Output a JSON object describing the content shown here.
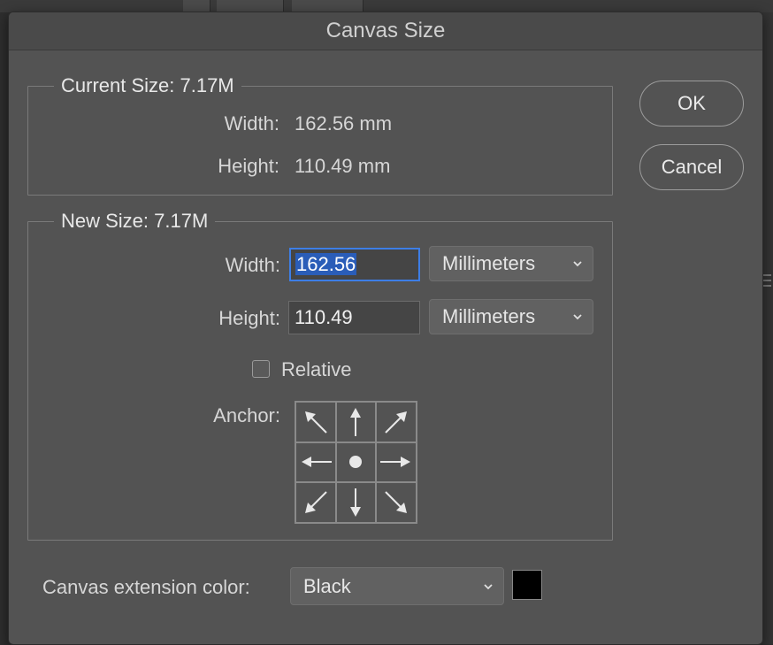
{
  "dialog": {
    "title": "Canvas Size"
  },
  "current_size": {
    "legend": "Current Size: 7.17M",
    "width_label": "Width:",
    "width_value": "162.56 mm",
    "height_label": "Height:",
    "height_value": "110.49 mm"
  },
  "new_size": {
    "legend": "New Size: 7.17M",
    "width_label": "Width:",
    "width_value": "162.56",
    "width_unit": "Millimeters",
    "height_label": "Height:",
    "height_value": "110.49",
    "height_unit": "Millimeters",
    "relative_label": "Relative",
    "relative_checked": false,
    "anchor_label": "Anchor:",
    "anchor_icons": [
      "arrow-up-left-icon",
      "arrow-up-icon",
      "arrow-up-right-icon",
      "arrow-left-icon",
      "anchor-center-dot-icon",
      "arrow-right-icon",
      "arrow-down-left-icon",
      "arrow-down-icon",
      "arrow-down-right-icon"
    ]
  },
  "extension": {
    "label": "Canvas extension color:",
    "value": "Black",
    "swatch_color": "#000000"
  },
  "buttons": {
    "ok": "OK",
    "cancel": "Cancel"
  },
  "colors": {
    "dialog_bg": "#535353",
    "focus_ring": "#3d7ee6",
    "selection": "#2a5db8"
  }
}
